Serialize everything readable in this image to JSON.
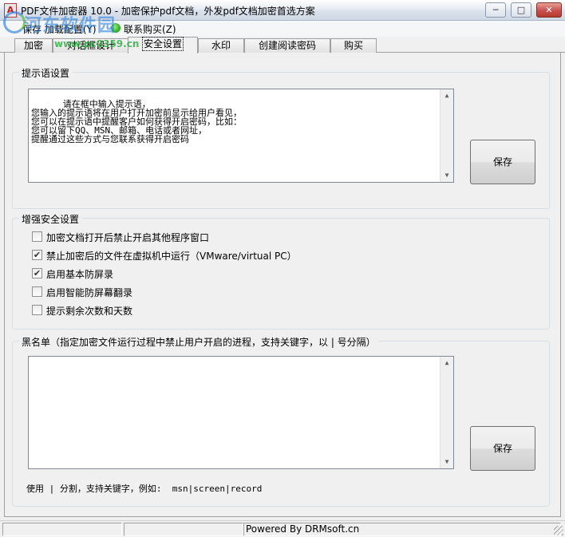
{
  "window": {
    "title": "PDF文件加密器 10.0 - 加密保护pdf文档，外发pdf文档加密首选方案",
    "icon_text": "A",
    "controls": {
      "min": "─",
      "max": "□",
      "close": "✕"
    }
  },
  "watermark": {
    "text_a": "河东软件园",
    "text_b": "www.pc0359.cn"
  },
  "menu": {
    "items": [
      {
        "label": "保存 加载配置(Y)"
      },
      {
        "label": "联系购买(Z)"
      }
    ]
  },
  "tabs": [
    {
      "label": "加密"
    },
    {
      "label": "对话框设计"
    },
    {
      "label": "安全设置"
    },
    {
      "label": "水印"
    },
    {
      "label": "创建阅读密码"
    },
    {
      "label": "购买"
    }
  ],
  "prompt_group": {
    "title": "提示语设置",
    "text": "请在框中输入提示语，\n您输入的提示语将在用户打开加密前显示给用户看见，\n您可以在提示语中提醒客户如何获得开启密码，比如：\n您可以留下QQ、MSN、邮箱、电话或者网址，\n提醒通过这些方式与您联系获得开启密码",
    "save_label": "保存"
  },
  "security_group": {
    "title": "增强安全设置",
    "options": [
      {
        "label": "加密文档打开后禁止开启其他程序窗口",
        "checked": false,
        "mark": ""
      },
      {
        "label": "禁止加密后的文件在虚拟机中运行（VMware/virtual PC）",
        "checked": true,
        "mark": "✔"
      },
      {
        "label": "启用基本防屏录",
        "checked": true,
        "mark": "✔"
      },
      {
        "label": "启用智能防屏幕翻录",
        "checked": false,
        "mark": ""
      },
      {
        "label": "提示剩余次数和天数",
        "checked": false,
        "mark": ""
      }
    ]
  },
  "blacklist_group": {
    "title": "黑名单（指定加密文件运行过程中禁止用户开启的进程，支持关键字，以 | 号分隔）",
    "text": "",
    "save_label": "保存",
    "hint": "使用 | 分割，支持关键字，例如:  msn|screen|record"
  },
  "status": {
    "powered": "Powered By DRMsoft.cn"
  }
}
